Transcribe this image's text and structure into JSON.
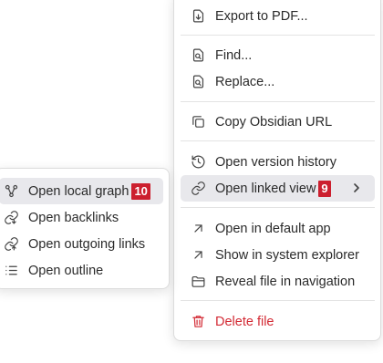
{
  "main_menu": {
    "items": [
      {
        "label": "Export to PDF...",
        "icon": "export-icon"
      },
      {
        "label": "Find...",
        "icon": "find-icon"
      },
      {
        "label": "Replace...",
        "icon": "replace-icon"
      },
      {
        "label": "Copy Obsidian URL",
        "icon": "copy-icon"
      },
      {
        "label": "Open version history",
        "icon": "history-icon"
      },
      {
        "label": "Open linked view",
        "icon": "link-icon",
        "badge": "9"
      },
      {
        "label": "Open in default app",
        "icon": "arrow-up-right-icon"
      },
      {
        "label": "Show in system explorer",
        "icon": "arrow-up-right-icon"
      },
      {
        "label": "Reveal file in navigation",
        "icon": "folder-icon"
      },
      {
        "label": "Delete file",
        "icon": "trash-icon"
      }
    ]
  },
  "sub_menu": {
    "items": [
      {
        "label": "Open local graph",
        "icon": "graph-icon",
        "badge": "10"
      },
      {
        "label": "Open backlinks",
        "icon": "backlinks-icon"
      },
      {
        "label": "Open outgoing links",
        "icon": "outgoing-links-icon"
      },
      {
        "label": "Open outline",
        "icon": "outline-icon"
      }
    ]
  },
  "colors": {
    "danger": "#d32b35",
    "badge": "#cc1f2e",
    "highlight": "#e8e8ec"
  }
}
